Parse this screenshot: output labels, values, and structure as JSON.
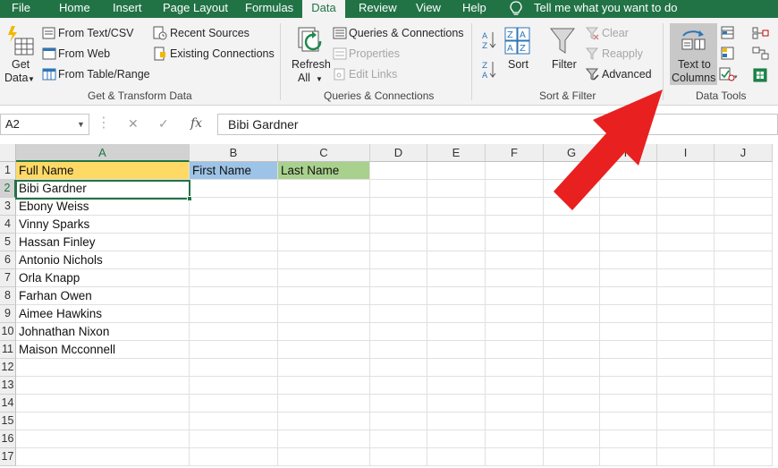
{
  "tabs": {
    "file": "File",
    "home": "Home",
    "insert": "Insert",
    "page_layout": "Page Layout",
    "formulas": "Formulas",
    "data": "Data",
    "review": "Review",
    "view": "View",
    "help": "Help",
    "tell_me": "Tell me what you want to do"
  },
  "ribbon": {
    "get_transform": {
      "get_data_line1": "Get",
      "get_data_line2": "Data",
      "from_text_csv": "From Text/CSV",
      "from_web": "From Web",
      "from_table_range": "From Table/Range",
      "recent_sources": "Recent Sources",
      "existing_connections": "Existing Connections",
      "label": "Get & Transform Data"
    },
    "queries": {
      "refresh_line1": "Refresh",
      "refresh_line2": "All",
      "queries_connections": "Queries & Connections",
      "properties": "Properties",
      "edit_links": "Edit Links",
      "label": "Queries & Connections"
    },
    "sort_filter": {
      "sort": "Sort",
      "filter": "Filter",
      "clear": "Clear",
      "reapply": "Reapply",
      "advanced": "Advanced",
      "label": "Sort & Filter"
    },
    "data_tools": {
      "text_to_columns_line1": "Text to",
      "text_to_columns_line2": "Columns",
      "label": "Data Tools"
    }
  },
  "formula_bar": {
    "name_box": "A2",
    "fx": "fx",
    "value": "Bibi Gardner"
  },
  "columns": [
    "A",
    "B",
    "C",
    "D",
    "E",
    "F",
    "G",
    "H",
    "I",
    "J"
  ],
  "rows": [
    "1",
    "2",
    "3",
    "4",
    "5",
    "6",
    "7",
    "8",
    "9",
    "10",
    "11",
    "12",
    "13",
    "14",
    "15",
    "16",
    "17"
  ],
  "cells": {
    "a1": "Full Name",
    "b1": "First Name",
    "c1": "Last Name",
    "names": [
      "Bibi Gardner",
      "Ebony Weiss",
      "Vinny Sparks",
      "Hassan Finley",
      "Antonio Nichols",
      "Orla Knapp",
      "Farhan Owen",
      "Aimee Hawkins",
      "Johnathan Nixon",
      "Maison Mcconnell"
    ]
  },
  "colors": {
    "excel_green": "#217346",
    "a1_fill": "#ffd966",
    "b1_fill": "#9dc3e6",
    "c1_fill": "#a9d18e",
    "arrow": "#e8201f"
  }
}
